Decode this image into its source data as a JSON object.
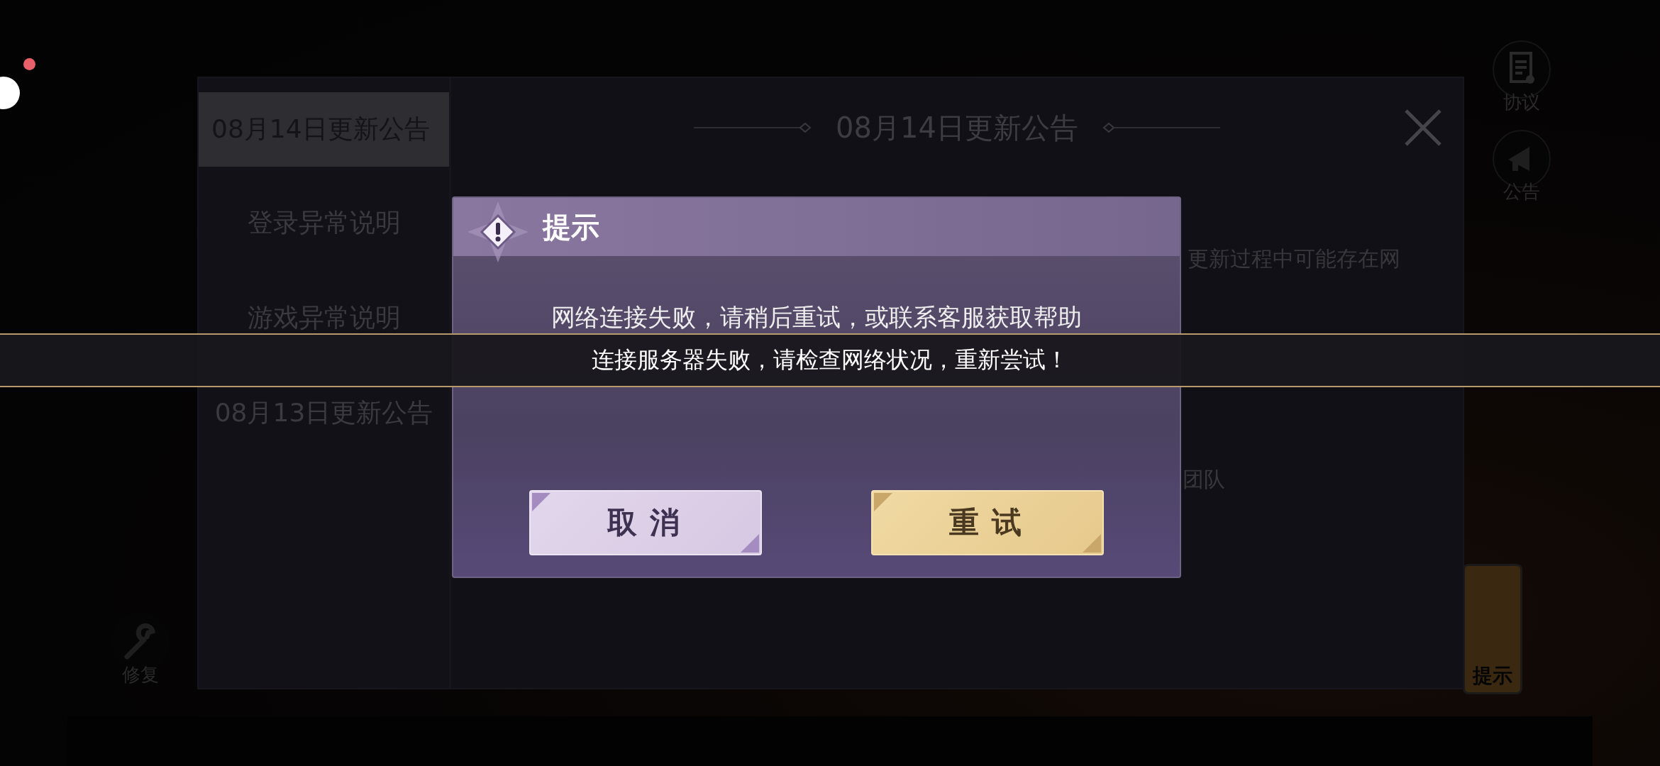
{
  "right_buttons": [
    {
      "label": "协议",
      "kind": "document"
    },
    {
      "label": "公告",
      "kind": "megaphone"
    }
  ],
  "repair_button": {
    "label": "修复",
    "kind": "wrench"
  },
  "notice_panel": {
    "tabs": [
      {
        "label": "08月14日更新公告",
        "selected": true
      },
      {
        "label": "登录异常说明",
        "selected": false
      },
      {
        "label": "游戏异常说明",
        "selected": false
      },
      {
        "label": "08月13日更新公告",
        "selected": false
      }
    ],
    "title": "08月14日更新公告",
    "body": [
      "更新过程中可能存在网",
      "团队"
    ]
  },
  "corner_badge": {
    "label": "提示"
  },
  "dialog": {
    "title": "提示",
    "message": "网络连接失败，请稍后重试，或联系客服获取帮助",
    "buttons": [
      {
        "label": "取消",
        "kind": "secondary"
      },
      {
        "label": "重试",
        "kind": "primary"
      }
    ]
  },
  "toast": {
    "message": "连接服务器失败，请检查网络状况，重新尝试！"
  }
}
